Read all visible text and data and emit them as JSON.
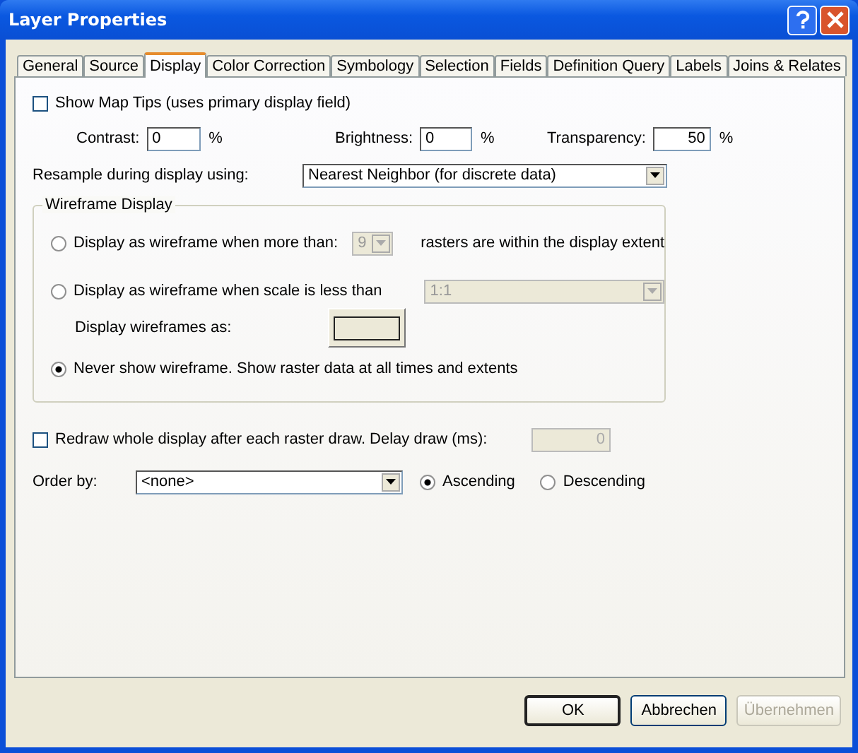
{
  "window": {
    "title": "Layer Properties"
  },
  "tabs": [
    {
      "label": "General",
      "selected": false
    },
    {
      "label": "Source",
      "selected": false
    },
    {
      "label": "Display",
      "selected": true
    },
    {
      "label": "Color Correction",
      "selected": false
    },
    {
      "label": "Symbology",
      "selected": false
    },
    {
      "label": "Selection",
      "selected": false
    },
    {
      "label": "Fields",
      "selected": false
    },
    {
      "label": "Definition Query",
      "selected": false
    },
    {
      "label": "Labels",
      "selected": false
    },
    {
      "label": "Joins & Relates",
      "selected": false
    }
  ],
  "map_tips": {
    "label": "Show Map Tips (uses primary display field)",
    "checked": false
  },
  "adjustments": [
    {
      "label": "Contrast:",
      "value": "0",
      "unit": "%"
    },
    {
      "label": "Brightness:",
      "value": "0",
      "unit": "%"
    },
    {
      "label": "Transparency:",
      "value": "50",
      "unit": "%"
    }
  ],
  "resample": {
    "label": "Resample during display using:",
    "value": "Nearest Neighbor (for discrete data)"
  },
  "wireframe": {
    "title": "Wireframe Display",
    "count_option": {
      "label": "Display as wireframe when more than:",
      "selected": false,
      "value": "9",
      "disabled": true,
      "suffix": "rasters are within the display extent"
    },
    "scale_option": {
      "label": "Display as wireframe when scale is less than",
      "selected": false,
      "value": "1:1",
      "disabled": true
    },
    "wireframes_as": {
      "label": "Display wireframes as:"
    },
    "never_option": {
      "label": "Never show wireframe. Show raster data at all times and extents",
      "selected": true
    }
  },
  "redraw": {
    "label": "Redraw whole display after each raster draw. Delay draw (ms):",
    "checked": false,
    "value": "0",
    "disabled": true
  },
  "order": {
    "label": "Order by:",
    "value": "<none>",
    "options": [
      {
        "label": "Ascending",
        "selected": true
      },
      {
        "label": "Descending",
        "selected": false
      }
    ]
  },
  "buttons": [
    {
      "label": "OK",
      "default": true,
      "disabled": false
    },
    {
      "label": "Abbrechen",
      "default": false,
      "disabled": false
    },
    {
      "label": "Übernehmen",
      "default": false,
      "disabled": true
    }
  ]
}
